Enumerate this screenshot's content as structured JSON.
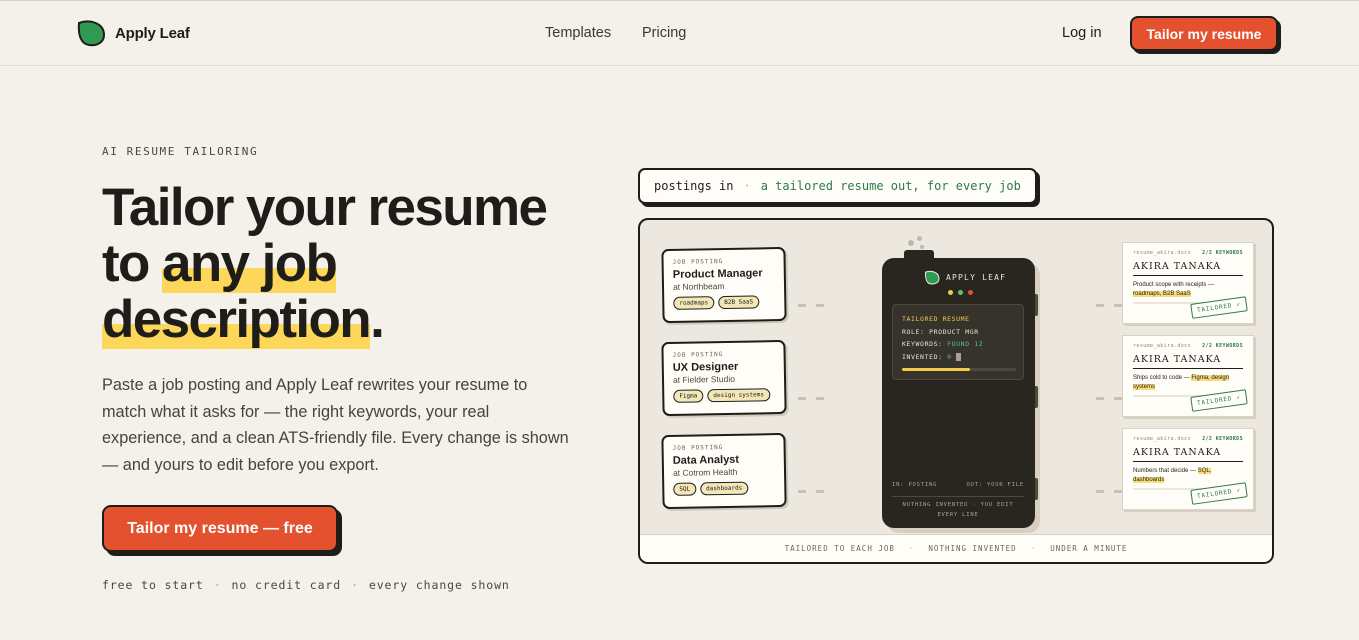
{
  "nav": {
    "brand": "Apply Leaf",
    "links": [
      "Templates",
      "Pricing"
    ],
    "login": "Log in",
    "cta": "Tailor my resume"
  },
  "hero": {
    "eyebrow": "AI RESUME TAILORING",
    "headline_1": "Tailor your resume",
    "headline_2a": "to ",
    "headline_2b": "any job",
    "headline_3a": "description",
    "headline_3b": ".",
    "lead": "Paste a job posting and Apply Leaf rewrites your resume to match what it asks for — the right keywords, your real experience, and a clean ATS-friendly file. Every change is shown — and yours to edit before you export.",
    "cta": "Tailor my resume — free",
    "footnotes": [
      "free to start",
      "no credit card",
      "every change shown"
    ],
    "footnote_sep": "·"
  },
  "tagline": {
    "input": "postings in",
    "sep": "·",
    "output": "a tailored resume out, for every job"
  },
  "illustration": {
    "jobs": [
      {
        "label": "JOB POSTING",
        "title": "Product Manager",
        "company": "at Northbeam",
        "tags": [
          "roadmaps",
          "B2B SaaS"
        ]
      },
      {
        "label": "JOB POSTING",
        "title": "UX Designer",
        "company": "at Fielder Studio",
        "tags": [
          "Figma",
          "design systems"
        ]
      },
      {
        "label": "JOB POSTING",
        "title": "Data Analyst",
        "company": "at Cotrom Health",
        "tags": [
          "SQL",
          "dashboards"
        ]
      }
    ],
    "device": {
      "brand": "APPLY LEAF",
      "screen_title": "TAILORED RESUME",
      "role_label": "ROLE:",
      "role_value": "PRODUCT MGR",
      "keywords_label": "KEYWORDS:",
      "keywords_value": "FOUND 12",
      "invented_label": "INVENTED:",
      "invented_value": "0",
      "progress": 0.6,
      "in_label": "IN: POSTING",
      "out_label": "OUT: YOUR FILE",
      "footer": "NOTHING INVENTED · YOU EDIT EVERY LINE"
    },
    "resumes": [
      {
        "file": "resume_akira.docx",
        "keywords": "2/2 KEYWORDS",
        "name": "AKIRA TANAKA",
        "line_a": "Product scope with receipts — ",
        "line_b": "roadmaps, B2B SaaS",
        "stamp": "TAILORED ✓"
      },
      {
        "file": "resume_akira.docx",
        "keywords": "2/2 KEYWORDS",
        "name": "AKIRA TANAKA",
        "line_a": "Ships cold to code — ",
        "line_b": "Figma, design systems",
        "stamp": "TAILORED ✓"
      },
      {
        "file": "resume_akira.docx",
        "keywords": "2/2 KEYWORDS",
        "name": "AKIRA TANAKA",
        "line_a": "Numbers that decide — ",
        "line_b": "SQL, dashboards",
        "stamp": "TAILORED ✓"
      }
    ],
    "footer": [
      "TAILORED TO EACH JOB",
      "NOTHING INVENTED",
      "UNDER A MINUTE"
    ],
    "footer_sep": "·"
  },
  "colors": {
    "background": "#f4f1ea",
    "accent": "#e3512f",
    "highlight": "#fcd75a",
    "brand_green": "#2e7a45",
    "ink": "#1e1d19"
  },
  "icons": {
    "logo": "leaf-icon"
  }
}
